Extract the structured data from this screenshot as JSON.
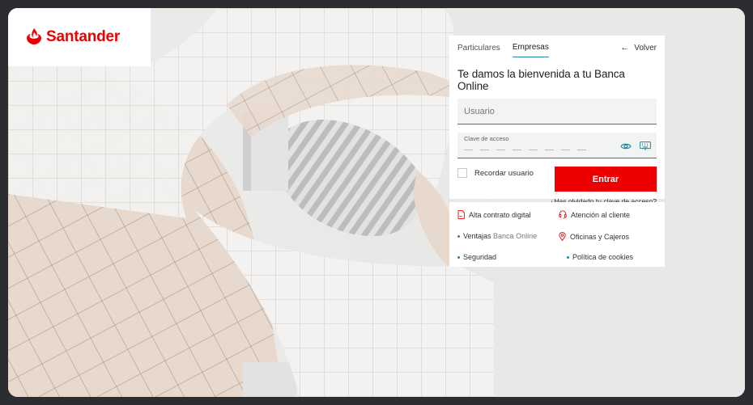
{
  "brand": {
    "name": "Santander",
    "color": "#ec0000",
    "accent": "#1b8a9c"
  },
  "login": {
    "tabs": [
      "Particulares",
      "Empresas"
    ],
    "active_tab": "Empresas",
    "back_label": "Volver",
    "welcome": "Te damos la bienvenida a tu Banca Online",
    "user_placeholder": "Usuario",
    "password_label": "Clave de acceso",
    "remember_label": "Recordar usuario",
    "enter_label": "Entrar",
    "forgot_label": "¿Has olvidado tu clave de acceso?"
  },
  "links": {
    "contract": "Alta contrato digital",
    "support": "Atención al cliente",
    "benefits_a": "Ventajas",
    "benefits_b": "Banca Online",
    "offices": "Oficinas y Cajeros",
    "security": "Seguridad",
    "cookies": "Política de cookies"
  },
  "icons": {
    "logo": "santander-flame-icon",
    "back": "arrow-left-icon",
    "show_password": "eye-icon",
    "virtual_keyboard": "keyboard-icon",
    "contract": "document-signature-icon",
    "support": "headset-icon",
    "offices": "location-pin-icon"
  }
}
